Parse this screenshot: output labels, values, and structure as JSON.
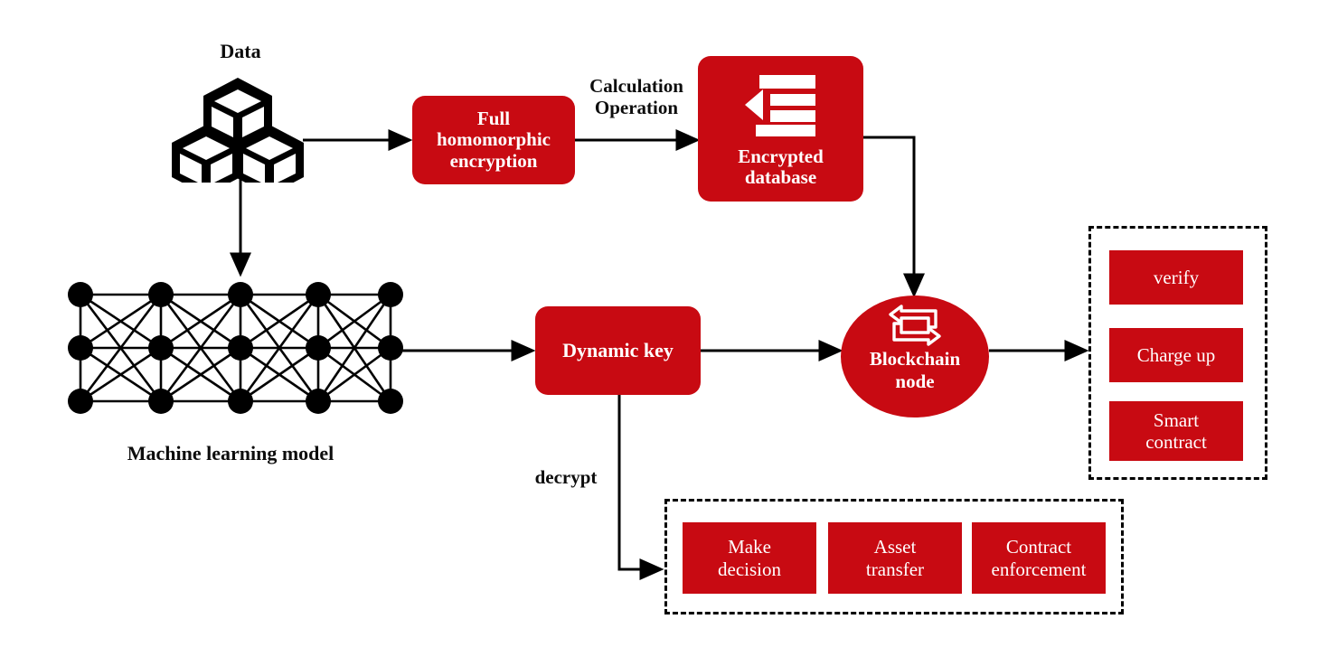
{
  "diagram": {
    "title": "Privacy-preserving blockchain machine learning architecture",
    "accent_color": "#C80A12",
    "line_color": "#000000",
    "background": "#ffffff"
  },
  "labels": {
    "data": "Data",
    "calculation_operation": "Calculation\nOperation",
    "machine_learning_model": "Machine learning model",
    "decrypt": "decrypt"
  },
  "nodes": {
    "full_homomorphic_encryption": "Full\nhomomorphic\nencryption",
    "encrypted_database": "Encrypted\ndatabase",
    "dynamic_key": "Dynamic key",
    "blockchain_node": "Blockchain\nnode"
  },
  "blockchain_services": {
    "items": [
      {
        "label": "verify"
      },
      {
        "label": "Charge up"
      },
      {
        "label": "Smart\ncontract"
      }
    ]
  },
  "decrypt_outcomes": {
    "items": [
      {
        "label": "Make\ndecision"
      },
      {
        "label": "Asset\ntransfer"
      },
      {
        "label": "Contract\nenforcement"
      }
    ]
  },
  "icons": {
    "data_cubes": "data-cubes-icon",
    "database_bars": "encrypted-database-icon",
    "sync_arrows": "blockchain-sync-icon",
    "neural_net": "neural-network-icon"
  },
  "neural_network": {
    "columns": 5,
    "rows": 3,
    "node_radius": 13
  }
}
